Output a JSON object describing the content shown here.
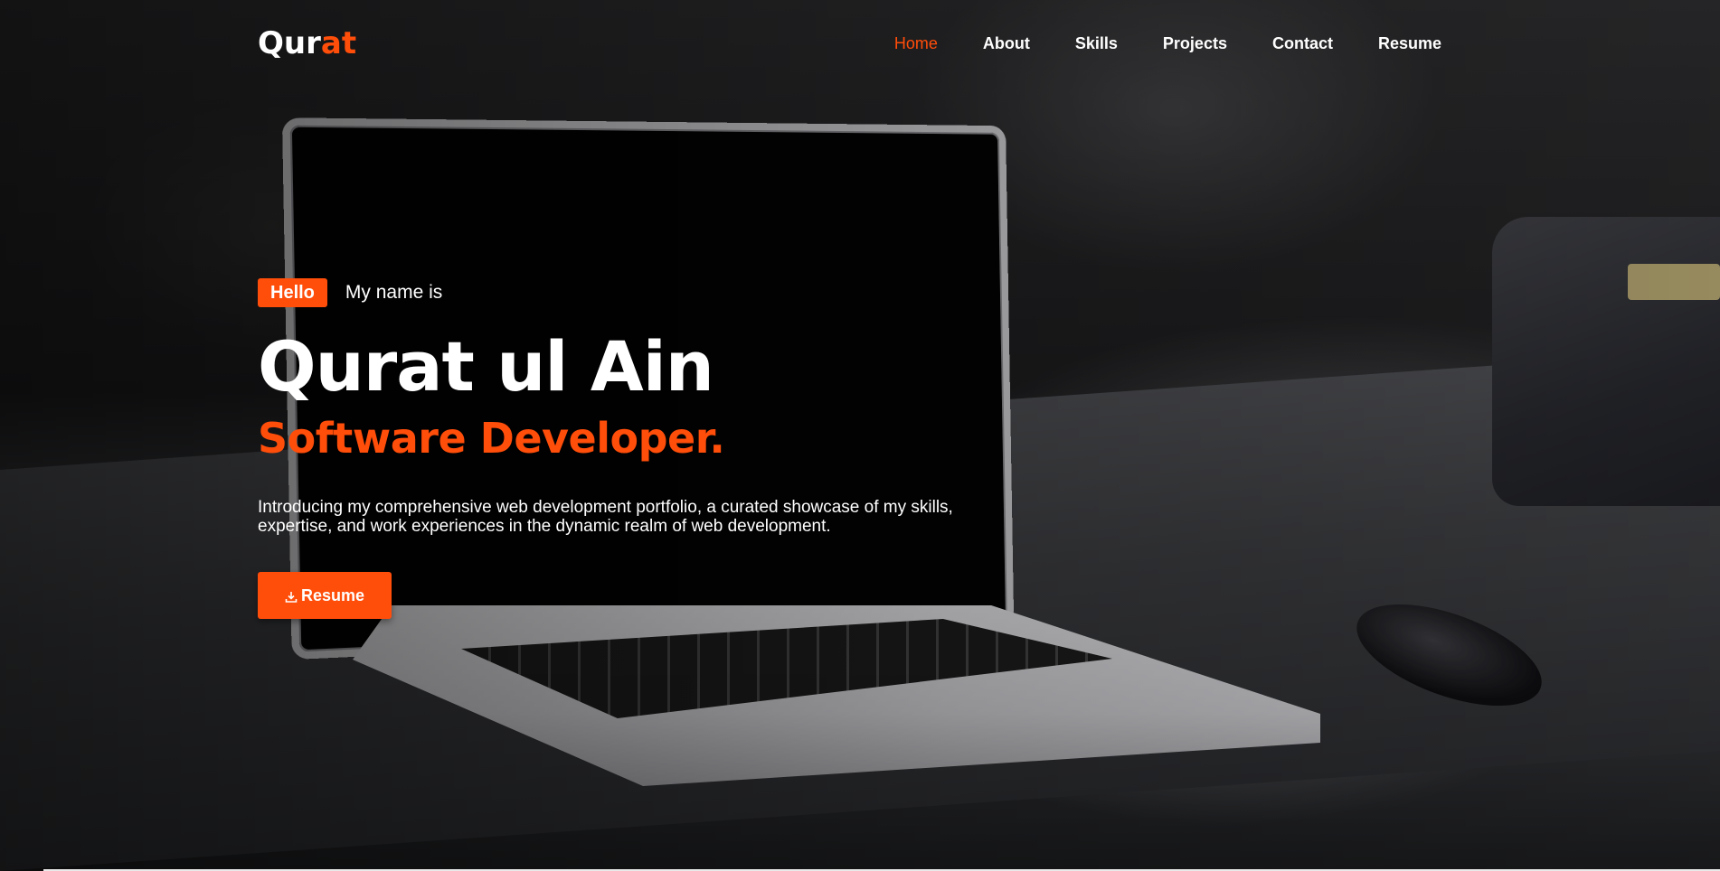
{
  "brand": {
    "logo_main": "Qur",
    "logo_accent": "at"
  },
  "nav": {
    "items": [
      {
        "label": "Home",
        "active": true
      },
      {
        "label": "About",
        "active": false
      },
      {
        "label": "Skills",
        "active": false
      },
      {
        "label": "Projects",
        "active": false
      },
      {
        "label": "Contact",
        "active": false
      },
      {
        "label": "Resume",
        "active": false
      }
    ]
  },
  "hero": {
    "badge": "Hello",
    "intro": "My name is",
    "name": "Qurat ul Ain",
    "role": "Software Developer.",
    "description": "Introducing my comprehensive web development portfolio, a curated showcase of my skills, expertise, and work experiences in the dynamic realm of web development.",
    "cta_label": "Resume",
    "cta_icon": "download-icon"
  },
  "colors": {
    "accent": "#ff4d0a",
    "text": "#ffffff"
  }
}
